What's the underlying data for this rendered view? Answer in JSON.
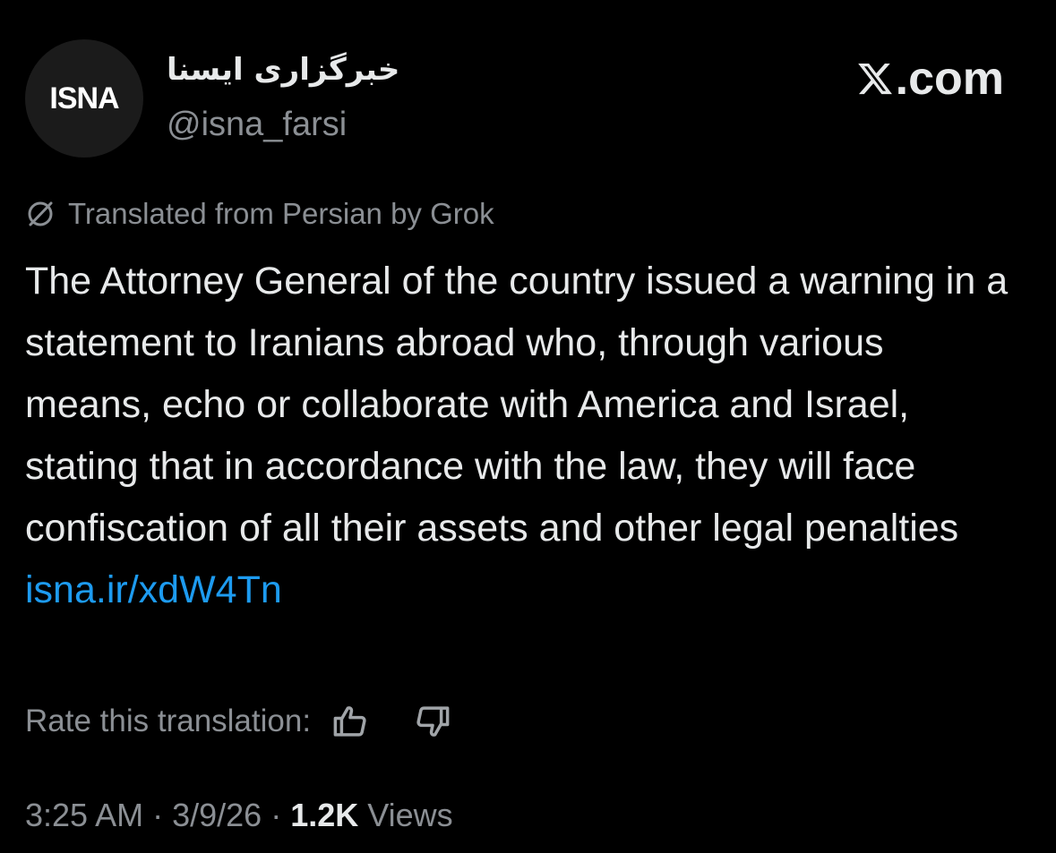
{
  "author": {
    "avatar_text": "ISNA",
    "display_name": "خبرگزاری ایسنا",
    "handle": "@isna_farsi"
  },
  "brand": {
    "label": ".com",
    "icon": "x-logo-icon"
  },
  "translation": {
    "notice": "Translated from Persian by Grok",
    "icon": "grok-icon"
  },
  "tweet": {
    "text": "The Attorney General of the country issued a warning in a statement to Iranians abroad who, through various means, echo or collaborate with America and Israel, stating that in accordance with the law, they will face confiscation of all their assets and other legal penalties",
    "link": "isna.ir/xdW4Tn"
  },
  "rating": {
    "label": "Rate this translation:",
    "thumbs_up_icon": "thumbs-up-icon",
    "thumbs_down_icon": "thumbs-down-icon"
  },
  "meta": {
    "time": "3:25 AM",
    "date": "3/9/26",
    "separator": "·",
    "views_count": "1.2K",
    "views_label": "Views"
  },
  "colors": {
    "background": "#000000",
    "text_primary": "#e7e9ea",
    "text_secondary": "#8b8f94",
    "link": "#1d9bf0"
  }
}
